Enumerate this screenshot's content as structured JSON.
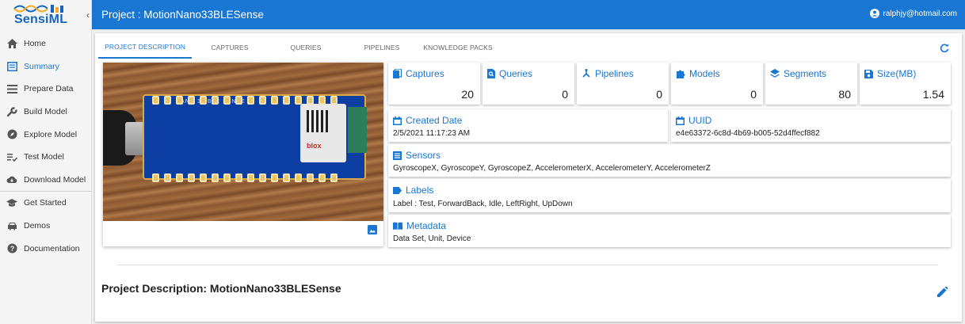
{
  "app": {
    "logo_text": "SensiML",
    "collapse_glyph": "‹",
    "colors": {
      "primary": "#1976d2",
      "sidebar_bg": "#f5f5f5"
    }
  },
  "sidebar": {
    "items": [
      {
        "label": "Home",
        "icon": "home-icon"
      },
      {
        "label": "Summary",
        "icon": "summary-icon",
        "active": true
      },
      {
        "label": "Prepare Data",
        "icon": "list-icon"
      },
      {
        "label": "Build Model",
        "icon": "wrench-icon"
      },
      {
        "label": "Explore Model",
        "icon": "compass-icon"
      },
      {
        "label": "Test Model",
        "icon": "checklist-icon"
      },
      {
        "label": "Download Model",
        "icon": "cloud-download-icon"
      },
      {
        "label": "Get Started",
        "icon": "graduation-cap-icon"
      },
      {
        "label": "Demos",
        "icon": "car-icon"
      },
      {
        "label": "Documentation",
        "icon": "help-icon"
      }
    ]
  },
  "topbar": {
    "project_title": "Project : MotionNano33BLESense",
    "user_email": "ralphjy@hotmail.com"
  },
  "tabs": [
    {
      "label": "PROJECT DESCRIPTION",
      "active": true
    },
    {
      "label": "CAPTURES"
    },
    {
      "label": "QUERIES"
    },
    {
      "label": "PIPELINES"
    },
    {
      "label": "KNOWLEDGE PACKS"
    }
  ],
  "photo": {
    "board_label": "NANO 33 BLE SENSE",
    "module_brand": "blox"
  },
  "stats": {
    "captures": {
      "label": "Captures",
      "value": "20"
    },
    "queries": {
      "label": "Queries",
      "value": "0"
    },
    "pipelines": {
      "label": "Pipelines",
      "value": "0"
    },
    "models": {
      "label": "Models",
      "value": "0"
    },
    "segments": {
      "label": "Segments",
      "value": "80"
    },
    "size": {
      "label": "Size(MB)",
      "value": "1.54"
    }
  },
  "info": {
    "created": {
      "label": "Created Date",
      "value": "2/5/2021 11:17:23 AM"
    },
    "uuid": {
      "label": "UUID",
      "value": "e4e63372-6c8d-4b69-b005-52d4ffecf882"
    },
    "sensors": {
      "label": "Sensors",
      "value": "GyroscopeX, GyroscopeY, GyroscopeZ, AccelerometerX, AccelerometerY, AccelerometerZ"
    },
    "labels": {
      "label": "Labels",
      "value": "Label : Test, ForwardBack, Idle, LeftRight, UpDown"
    },
    "metadata": {
      "label": "Metadata",
      "value": "Data Set, Unit, Device"
    }
  },
  "description": {
    "title": "Project Description: MotionNano33BLESense"
  }
}
